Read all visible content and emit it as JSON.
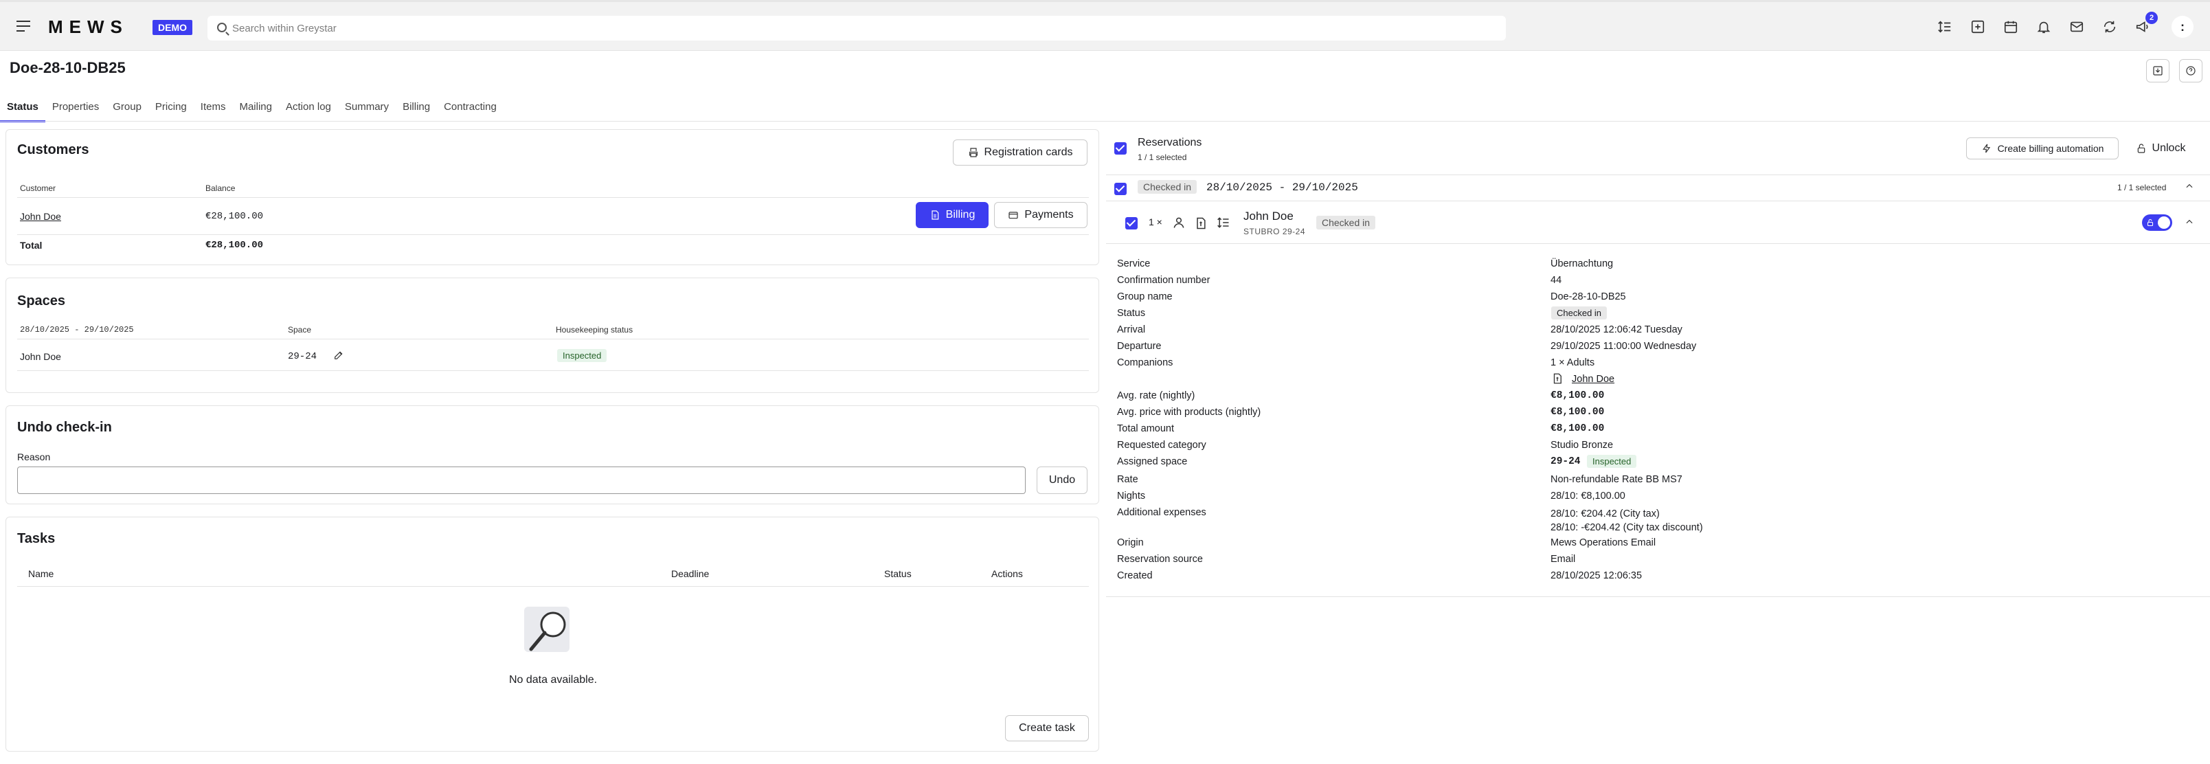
{
  "topbar": {
    "logo": "MEWS",
    "env_badge": "DEMO",
    "search_placeholder": "Search within Greystar",
    "notification_count": "2",
    "profile_initial": ":"
  },
  "page": {
    "title": "Doe-28-10-DB25",
    "tabs": [
      "Status",
      "Properties",
      "Group",
      "Pricing",
      "Items",
      "Mailing",
      "Action log",
      "Summary",
      "Billing",
      "Contracting"
    ]
  },
  "customers": {
    "heading": "Customers",
    "registration_cards": "Registration cards",
    "col_customer": "Customer",
    "col_balance": "Balance",
    "row_name": "John Doe",
    "row_balance": "€28,100.00",
    "billing": "Billing",
    "payments": "Payments",
    "total_label": "Total",
    "total_value": "€28,100.00"
  },
  "spaces": {
    "heading": "Spaces",
    "col_dates": "28/10/2025 - 29/10/2025",
    "col_space": "Space",
    "col_housekeeping": "Housekeeping status",
    "row_name": "John Doe",
    "row_space": "29-24",
    "row_status": "Inspected"
  },
  "undo": {
    "heading": "Undo check-in",
    "reason_label": "Reason",
    "reason_value": "",
    "undo_button": "Undo"
  },
  "tasks": {
    "heading": "Tasks",
    "col_name": "Name",
    "col_deadline": "Deadline",
    "col_status": "Status",
    "col_actions": "Actions",
    "empty": "No data available.",
    "create_task": "Create task"
  },
  "reservations": {
    "heading": "Reservations",
    "selected": "1 / 1 selected",
    "create_billing_automation": "Create billing automation",
    "unlock": "Unlock",
    "group_status": "Checked in",
    "group_dates": "28/10/2025 - 29/10/2025",
    "group_selected": "1 / 1 selected",
    "count": "1 ×",
    "guest_name": "John Doe",
    "guest_sub": "STUBRO 29-24",
    "guest_status": "Checked in"
  },
  "details": {
    "service_label": "Service",
    "service": "Übernachtung",
    "confirmation_label": "Confirmation number",
    "confirmation": "44",
    "group_label": "Group name",
    "group": "Doe-28-10-DB25",
    "status_label": "Status",
    "status": "Checked in",
    "arrival_label": "Arrival",
    "arrival": "28/10/2025 12:06:42 Tuesday",
    "departure_label": "Departure",
    "departure": "29/10/2025 11:00:00 Wednesday",
    "companions_label": "Companions",
    "companions": "1 × Adults",
    "companion_name": "John Doe",
    "avg_rate_label": "Avg. rate (nightly)",
    "avg_rate": "€8,100.00",
    "avg_price_label": "Avg. price with products (nightly)",
    "avg_price": "€8,100.00",
    "total_label": "Total amount",
    "total": "€8,100.00",
    "req_cat_label": "Requested category",
    "req_cat": "Studio Bronze",
    "assigned_label": "Assigned space",
    "assigned": "29-24",
    "assigned_status": "Inspected",
    "rate_label": "Rate",
    "rate": "Non-refundable Rate BB MS7",
    "nights_label": "Nights",
    "nights": "28/10: €8,100.00",
    "expenses_label": "Additional expenses",
    "expense_1": "28/10: €204.42 (City tax)",
    "expense_2": "28/10: -€204.42 (City tax discount)",
    "origin_label": "Origin",
    "origin": "Mews Operations Email",
    "source_label": "Reservation source",
    "source": "Email",
    "created_label": "Created",
    "created": "28/10/2025 12:06:35"
  }
}
